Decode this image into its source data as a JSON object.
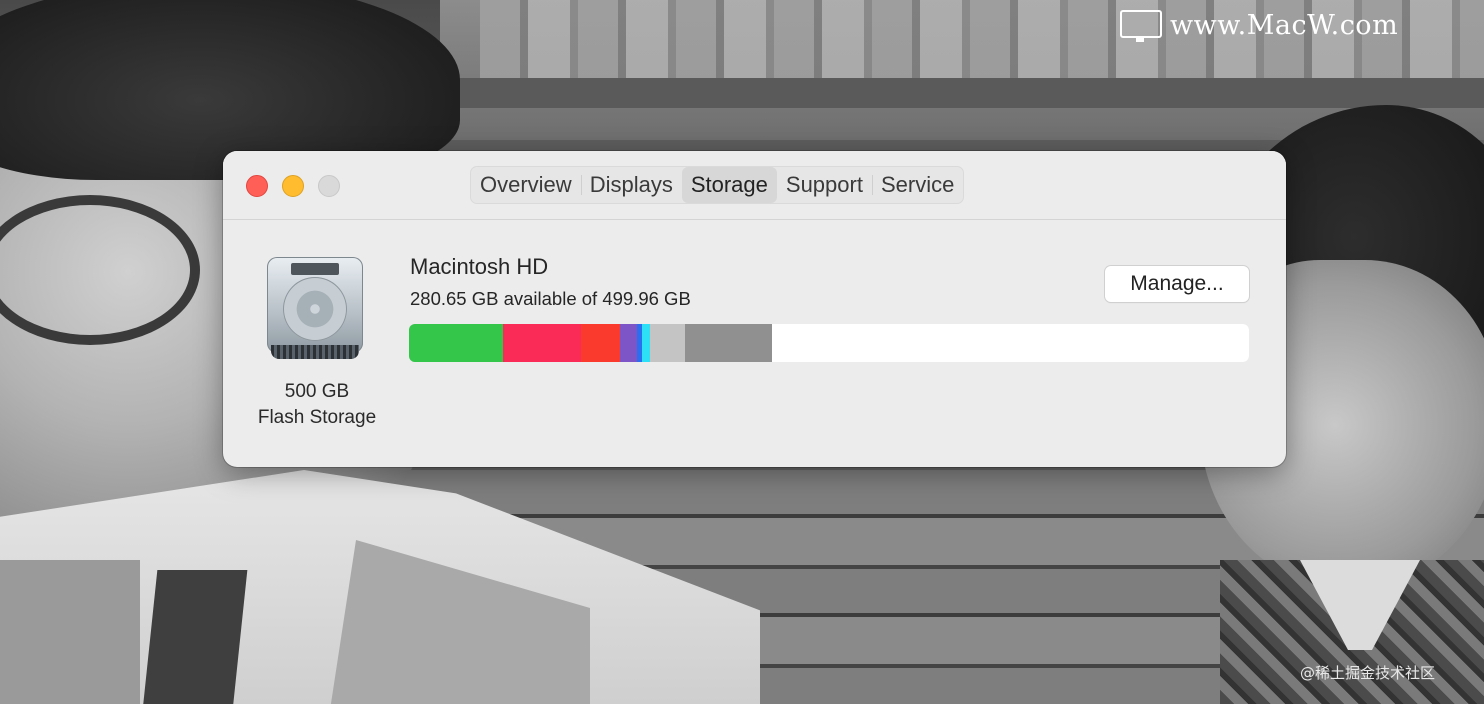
{
  "watermark": {
    "site": "www.MacW.com",
    "footer": "@稀土掘金技术社区"
  },
  "window": {
    "traffic_lights": {
      "close": "#ff5f57",
      "minimize": "#febc2e",
      "zoom": "#d9d9d9"
    },
    "tabs": [
      {
        "label": "Overview",
        "active": false
      },
      {
        "label": "Displays",
        "active": false
      },
      {
        "label": "Storage",
        "active": true
      },
      {
        "label": "Support",
        "active": false
      },
      {
        "label": "Service",
        "active": false
      }
    ],
    "disk": {
      "icon": "hard-disk-icon",
      "capacity_label": "500 GB",
      "type_label": "Flash Storage"
    },
    "volume": {
      "name": "Macintosh HD",
      "availability": "280.65 GB available of 499.96 GB",
      "manage_label": "Manage..."
    },
    "usage_bar": {
      "segments": [
        {
          "color": "#34c64a",
          "fraction": 0.112
        },
        {
          "color": "#fa2c57",
          "fraction": 0.093
        },
        {
          "color": "#fb3a2e",
          "fraction": 0.047
        },
        {
          "color": "#7d55c7",
          "fraction": 0.02
        },
        {
          "color": "#2c6ef0",
          "fraction": 0.006
        },
        {
          "color": "#2ee0f6",
          "fraction": 0.009
        },
        {
          "color": "#c4c4c4",
          "fraction": 0.042
        },
        {
          "color": "#909090",
          "fraction": 0.104
        }
      ],
      "free_color": "#ffffff"
    }
  }
}
